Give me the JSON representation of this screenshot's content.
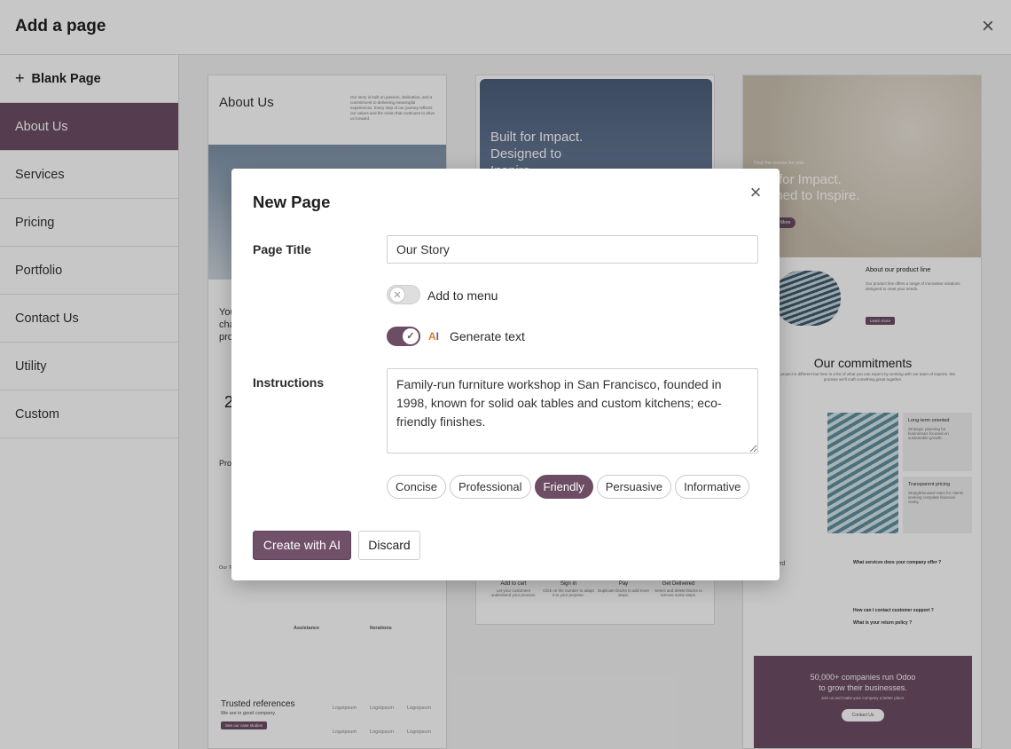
{
  "window": {
    "title": "Add a page"
  },
  "sidebar": {
    "blank_label": "Blank Page",
    "items": [
      {
        "label": "About Us",
        "active": true
      },
      {
        "label": "Services"
      },
      {
        "label": "Pricing"
      },
      {
        "label": "Portfolio"
      },
      {
        "label": "Contact Us"
      },
      {
        "label": "Utility"
      },
      {
        "label": "Custom"
      }
    ]
  },
  "previews": {
    "about": {
      "title": "About Us",
      "intro": "Our story is built on passion, dedication, and a commitment to delivering meaningful experiences. Every step of our journey reflects our values and the vision that continues to drive us forward.",
      "frag_text": "You\ncha\npro",
      "stat": "2",
      "section_label": "Pro",
      "our_label": "Our Te",
      "assistance": "Assistance",
      "iterations": "Iterations",
      "trusted_title": "Trusted references",
      "trusted_sub": "We are in good company.",
      "trusted_btn": "See our case studies",
      "logo": "Logoipsum"
    },
    "services": {
      "hero": "Built for Impact.\nDesigned to\nInspire",
      "steps": [
        {
          "title": "Add to cart",
          "desc": "Let your customers understand your process."
        },
        {
          "title": "Sign in",
          "desc": "Click on the number to adapt it to your purpose."
        },
        {
          "title": "Pay",
          "desc": "Duplicate blocks to add more steps."
        },
        {
          "title": "Get Delivered",
          "desc": "Select and delete blocks to remove some steps."
        }
      ]
    },
    "product": {
      "hero_sub": "Find the course for you",
      "hero_line1": "for Impact.",
      "hero_line2": "gned to Inspire.",
      "hero_btn": "More",
      "product_head": "About our product line",
      "product_text": "Our product line offers a range of innovative solutions designed to meet your needs.",
      "product_btn": "Learn more",
      "commit_title": "Our commitments",
      "commit_sub": "Each project is different but here is a list of what you can expect by working with our team of experts. We promise we'll craft something great together.",
      "box1_title": "Long-term oriented",
      "box1_text": "Strategic planning for businesses focused on sustainable growth.",
      "box2_title": "Transparent pricing",
      "box2_text": "Straightforward rates for clients seeking complete financial clarity.",
      "faq_title": "ently asked\nns",
      "faq_q1": "What services does your company offer ?",
      "faq_q2": "How can I contact customer support ?",
      "faq_q3": "What is your return policy ?",
      "cta_title": "50,000+ companies run Odoo\nto grow their businesses.",
      "cta_sub": "Join us and make your company a better place.",
      "cta_btn": "Contact Us"
    }
  },
  "modal": {
    "title": "New Page",
    "page_title_label": "Page Title",
    "page_title_value": "Our Story",
    "add_to_menu_label": "Add to menu",
    "add_to_menu": false,
    "generate_text_label": "Generate text",
    "generate_text": true,
    "instructions_label": "Instructions",
    "instructions_value": "Family-run furniture workshop in San Francisco, founded in 1998, known for solid oak tables and custom kitchens; eco-friendly finishes.",
    "tones": [
      {
        "label": "Concise"
      },
      {
        "label": "Professional"
      },
      {
        "label": "Friendly",
        "active": true
      },
      {
        "label": "Persuasive"
      },
      {
        "label": "Informative"
      }
    ],
    "create_label": "Create with AI",
    "discard_label": "Discard"
  },
  "colors": {
    "accent": "#6d4d64",
    "overlay": "rgba(0,0,0,0.22)"
  },
  "icons": {
    "close": "close-icon",
    "plus": "plus-icon",
    "ai": "ai-icon",
    "check": "check-icon"
  }
}
